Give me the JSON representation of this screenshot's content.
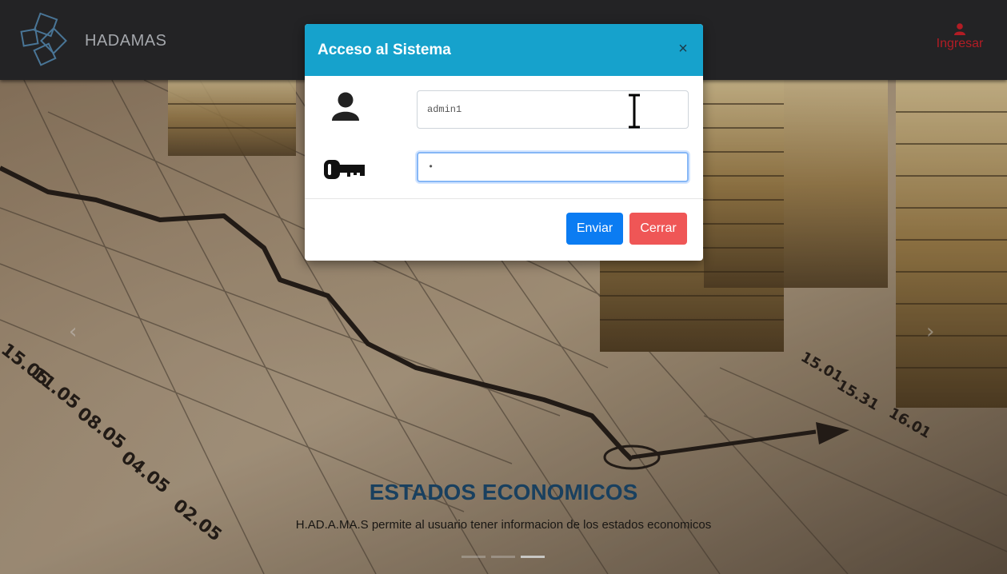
{
  "navbar": {
    "brand": "HADAMAS",
    "login_label": "Ingresar",
    "login_icon": "user-icon"
  },
  "hero": {
    "title": "ESTADOS ECONOMICOS",
    "subtitle": "H.AD.A.MA.S permite al usuario tener informacion de los estados economicos",
    "prev_icon": "‹",
    "next_icon": "›",
    "slides": 3,
    "active_slide": 3,
    "background_labels": [
      "15.05",
      "11.05",
      "08.05",
      "04.05",
      "02.05",
      "15.01",
      "15.31",
      "16.01"
    ]
  },
  "modal": {
    "title": "Acceso al Sistema",
    "close_symbol": "×",
    "username_value": "admin1",
    "username_icon": "user-icon",
    "password_value": "•",
    "password_icon": "key-icon",
    "send_label": "Enviar",
    "close_label": "Cerrar"
  },
  "colors": {
    "navbar": "#2b2b2e",
    "modal_header": "#16a2cc",
    "send_button": "#0b7cf2",
    "close_button": "#ef5656",
    "login_link": "#d9232d",
    "caption_title": "#1f4f74"
  }
}
